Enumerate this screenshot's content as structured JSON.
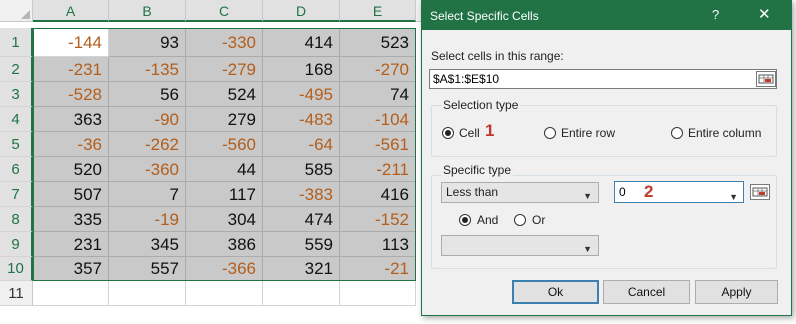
{
  "spreadsheet": {
    "columns": [
      "A",
      "B",
      "C",
      "D",
      "E"
    ],
    "rows": [
      "1",
      "2",
      "3",
      "4",
      "5",
      "6",
      "7",
      "8",
      "9",
      "10",
      "11"
    ],
    "values": [
      [
        "-144",
        "93",
        "-330",
        "414",
        "523"
      ],
      [
        "-231",
        "-135",
        "-279",
        "168",
        "-270"
      ],
      [
        "-528",
        "56",
        "524",
        "-495",
        "74"
      ],
      [
        "363",
        "-90",
        "279",
        "-483",
        "-104"
      ],
      [
        "-36",
        "-262",
        "-560",
        "-64",
        "-561"
      ],
      [
        "520",
        "-360",
        "44",
        "585",
        "-211"
      ],
      [
        "507",
        "7",
        "117",
        "-383",
        "416"
      ],
      [
        "335",
        "-19",
        "304",
        "474",
        "-152"
      ],
      [
        "231",
        "345",
        "386",
        "559",
        "113"
      ],
      [
        "357",
        "557",
        "-366",
        "321",
        "-21"
      ]
    ],
    "colors": {
      "negative": "#b35e1c",
      "positive": "#111111",
      "selection": "#217346"
    }
  },
  "dialog": {
    "title": "Select Specific Cells",
    "help_label": "?",
    "close_icon": "close-icon",
    "range_label": "Select cells in this range:",
    "range_value": "$A$1:$E$10",
    "selection_type": {
      "label": "Selection type",
      "options": [
        "Cell",
        "Entire row",
        "Entire column"
      ],
      "selected": "Cell"
    },
    "specific_type": {
      "label": "Specific type",
      "condition1": "Less than",
      "value1": "0",
      "logic_options": [
        "And",
        "Or"
      ],
      "logic_selected": "And",
      "condition2": "",
      "value2": ""
    },
    "step_badges": [
      "1",
      "2"
    ],
    "buttons": {
      "ok": "Ok",
      "cancel": "Cancel",
      "apply": "Apply"
    },
    "colors": {
      "titlebar": "#217346",
      "badge": "#c0392b",
      "focus": "#3c7fb1"
    }
  }
}
